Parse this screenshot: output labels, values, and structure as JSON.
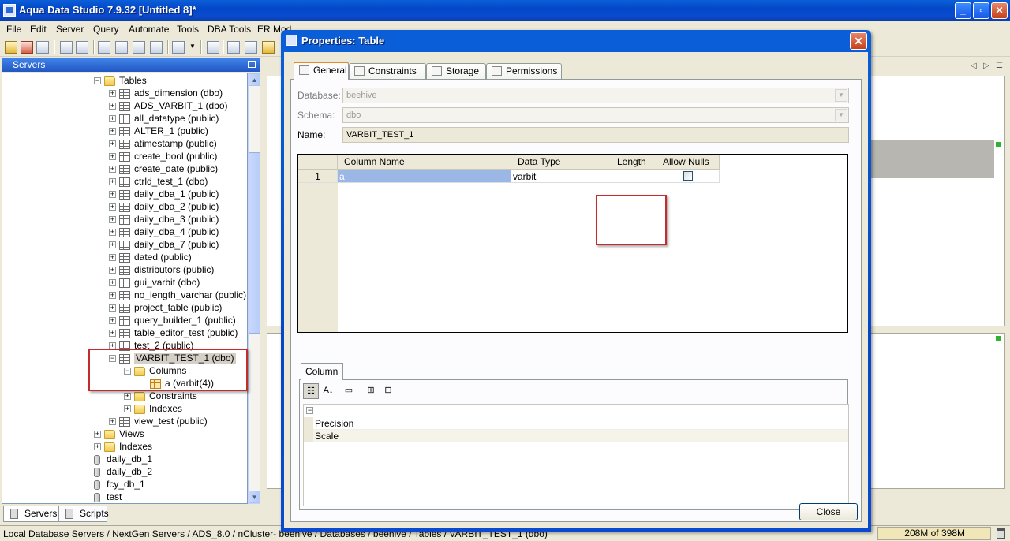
{
  "window": {
    "title": "Aqua Data Studio 7.9.32 [Untitled 8]*"
  },
  "menu": [
    "File",
    "Edit",
    "Server",
    "Query",
    "Automate",
    "Tools",
    "DBA Tools",
    "ER Mod"
  ],
  "servers_panel": {
    "header": "Servers",
    "tree": [
      {
        "label": "Tables",
        "indent": 2,
        "icon": "folder",
        "expander": "−"
      },
      {
        "label": "ads_dimension (dbo)",
        "indent": 3,
        "icon": "table",
        "expander": "+"
      },
      {
        "label": "ADS_VARBIT_1 (dbo)",
        "indent": 3,
        "icon": "table",
        "expander": "+"
      },
      {
        "label": "all_datatype (public)",
        "indent": 3,
        "icon": "table",
        "expander": "+"
      },
      {
        "label": "ALTER_1 (public)",
        "indent": 3,
        "icon": "table",
        "expander": "+"
      },
      {
        "label": "atimestamp (public)",
        "indent": 3,
        "icon": "table",
        "expander": "+"
      },
      {
        "label": "create_bool (public)",
        "indent": 3,
        "icon": "table",
        "expander": "+"
      },
      {
        "label": "create_date (public)",
        "indent": 3,
        "icon": "table",
        "expander": "+"
      },
      {
        "label": "ctrld_test_1 (dbo)",
        "indent": 3,
        "icon": "table",
        "expander": "+"
      },
      {
        "label": "daily_dba_1 (public)",
        "indent": 3,
        "icon": "table",
        "expander": "+"
      },
      {
        "label": "daily_dba_2 (public)",
        "indent": 3,
        "icon": "table",
        "expander": "+"
      },
      {
        "label": "daily_dba_3 (public)",
        "indent": 3,
        "icon": "table",
        "expander": "+"
      },
      {
        "label": "daily_dba_4 (public)",
        "indent": 3,
        "icon": "table",
        "expander": "+"
      },
      {
        "label": "daily_dba_7 (public)",
        "indent": 3,
        "icon": "table",
        "expander": "+"
      },
      {
        "label": "dated (public)",
        "indent": 3,
        "icon": "table",
        "expander": "+"
      },
      {
        "label": "distributors (public)",
        "indent": 3,
        "icon": "table",
        "expander": "+"
      },
      {
        "label": "gui_varbit (dbo)",
        "indent": 3,
        "icon": "table",
        "expander": "+"
      },
      {
        "label": "no_length_varchar (public)",
        "indent": 3,
        "icon": "table",
        "expander": "+"
      },
      {
        "label": "project_table (public)",
        "indent": 3,
        "icon": "table",
        "expander": "+"
      },
      {
        "label": "query_builder_1 (public)",
        "indent": 3,
        "icon": "table",
        "expander": "+"
      },
      {
        "label": "table_editor_test (public)",
        "indent": 3,
        "icon": "table",
        "expander": "+"
      },
      {
        "label": "test_2 (public)",
        "indent": 3,
        "icon": "table",
        "expander": "+"
      },
      {
        "label": "VARBIT_TEST_1 (dbo)",
        "indent": 3,
        "icon": "table",
        "expander": "−",
        "selected": true
      },
      {
        "label": "Columns",
        "indent": 4,
        "icon": "folder",
        "expander": "−"
      },
      {
        "label": "a (varbit(4))",
        "indent": 5,
        "icon": "table-sel",
        "expander": ""
      },
      {
        "label": "Constraints",
        "indent": 4,
        "icon": "folder",
        "expander": "+"
      },
      {
        "label": "Indexes",
        "indent": 4,
        "icon": "folder",
        "expander": "+"
      },
      {
        "label": "view_test (public)",
        "indent": 3,
        "icon": "table",
        "expander": "+"
      },
      {
        "label": "Views",
        "indent": 2,
        "icon": "folder",
        "expander": "+"
      },
      {
        "label": "Indexes",
        "indent": 2,
        "icon": "folder",
        "expander": "+"
      },
      {
        "label": "daily_db_1",
        "indent": 1,
        "icon": "db",
        "expander": ""
      },
      {
        "label": "daily_db_2",
        "indent": 1,
        "icon": "db",
        "expander": ""
      },
      {
        "label": "fcy_db_1",
        "indent": 1,
        "icon": "db",
        "expander": ""
      },
      {
        "label": "test",
        "indent": 1,
        "icon": "db",
        "expander": ""
      }
    ],
    "bottom_tabs": [
      "Servers",
      "Scripts"
    ]
  },
  "status": {
    "path": "Local Database Servers / NextGen Servers / ADS_8.0 / nCluster- beehive / Databases / beehive / Tables / VARBIT_TEST_1 (dbo)",
    "memory": "208M of 398M"
  },
  "dialog": {
    "title": "Properties: Table",
    "tabs": [
      "General",
      "Constraints",
      "Storage",
      "Permissions"
    ],
    "active_tab": "General",
    "fields": {
      "database_label": "Database:",
      "database_value": "beehive",
      "schema_label": "Schema:",
      "schema_value": "dbo",
      "name_label": "Name:",
      "name_value": "VARBIT_TEST_1"
    },
    "grid": {
      "columns": [
        "Column Name",
        "Data Type",
        "Length",
        "Allow Nulls"
      ],
      "rows": [
        {
          "num": "1",
          "name": "a",
          "type": "varbit",
          "length": "",
          "allow_nulls": false
        }
      ]
    },
    "column_tab": "Column",
    "properties": [
      {
        "name": "Precision",
        "value": ""
      },
      {
        "name": "Scale",
        "value": ""
      }
    ],
    "close_label": "Close"
  },
  "colors": {
    "titlebar": "#0348c8",
    "highlight": "#c52b2b",
    "selection": "#9ab7e6"
  }
}
